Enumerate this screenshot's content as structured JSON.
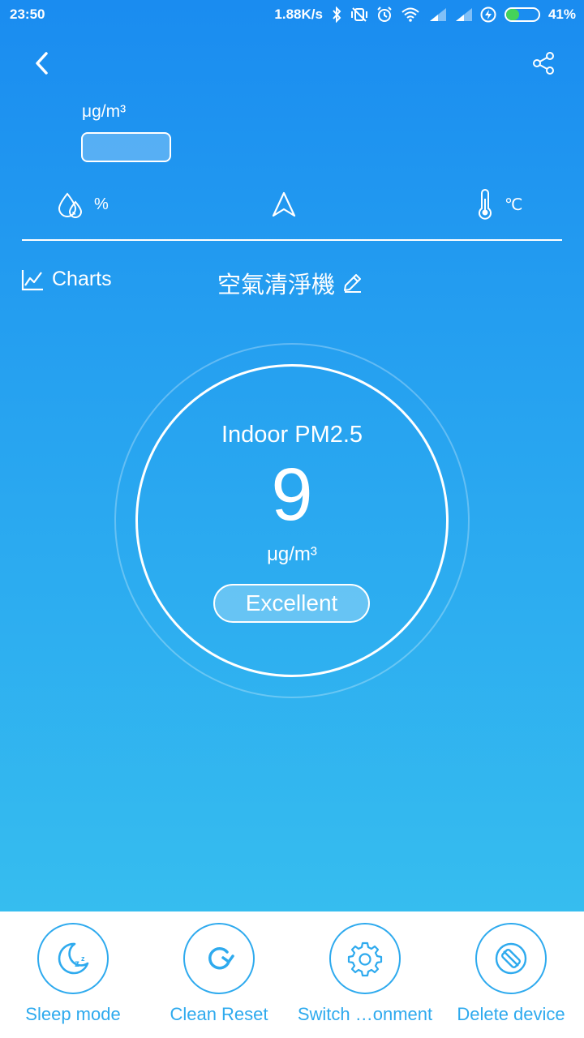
{
  "status_bar": {
    "time": "23:50",
    "network_speed": "1.88K/s",
    "battery_percent": "41%",
    "battery_level": 0.41,
    "icons": [
      "bluetooth-icon",
      "vibrate-off-icon",
      "alarm-icon",
      "wifi-icon",
      "signal-icon",
      "signal-icon",
      "charging-icon",
      "battery-icon"
    ]
  },
  "header": {
    "back_icon": "chevron-left-icon",
    "share_icon": "share-icon"
  },
  "outdoor": {
    "unit": "μg/m³"
  },
  "metrics": {
    "humidity_unit": "%",
    "humidity_icon": "water-drops-icon",
    "wind_icon": "navigation-arrow-icon",
    "temperature_unit": "℃",
    "temperature_icon": "thermometer-icon"
  },
  "nav": {
    "charts_label": "Charts",
    "charts_icon": "line-chart-icon",
    "device_name": "空氣清淨機",
    "edit_icon": "pencil-icon"
  },
  "indoor": {
    "label": "Indoor PM2.5",
    "value": "9",
    "unit": "μg/m³",
    "quality": "Excellent"
  },
  "actions": [
    {
      "label": "Sleep mode",
      "icon": "sleep-moon-icon"
    },
    {
      "label": "Clean Reset",
      "icon": "refresh-icon"
    },
    {
      "label": "Switch …onment",
      "icon": "gear-icon"
    },
    {
      "label": "Delete device",
      "icon": "delete-device-icon"
    }
  ],
  "colors": {
    "gradient_top": "#1a8cf0",
    "gradient_bottom": "#36bdef",
    "accent": "#2eaaee",
    "battery_green": "#44d35a"
  }
}
